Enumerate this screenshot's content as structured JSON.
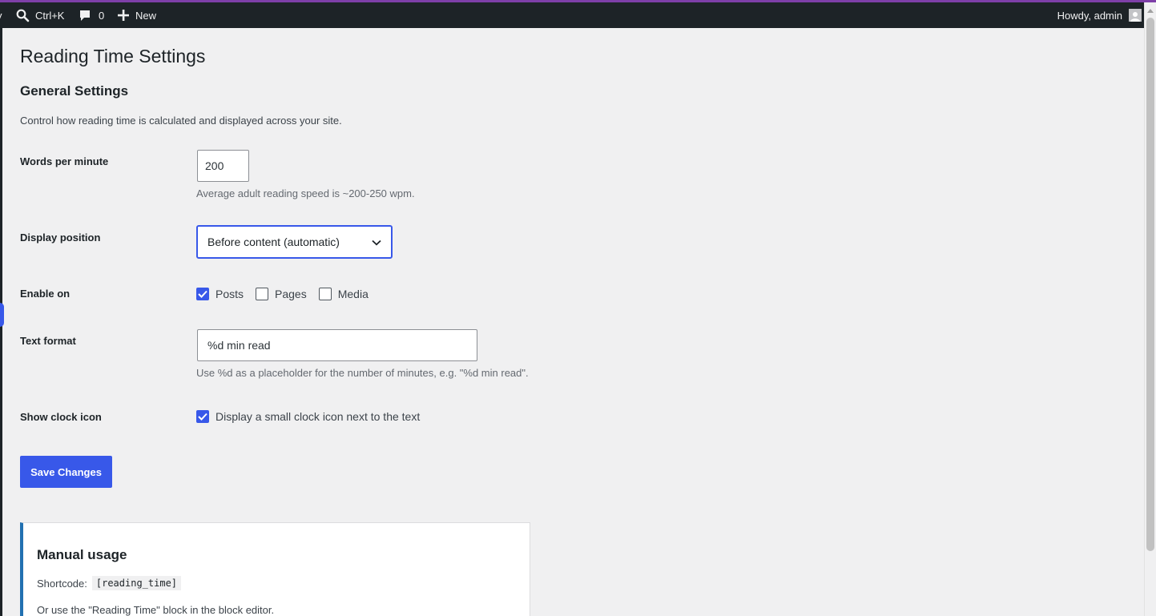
{
  "colors": {
    "accent": "#3858e9",
    "admin_bar": "#1d2327",
    "background": "#f0f0f1",
    "card_border": "#2271b1"
  },
  "adminbar": {
    "search_shortcut": "Ctrl+K",
    "comments_count": "0",
    "new_label": "New",
    "howdy": "Howdy, admin",
    "icons": [
      "search-icon",
      "comment-bubble-icon",
      "plus-icon",
      "avatar-icon"
    ]
  },
  "page": {
    "title": "Reading Time Settings"
  },
  "general": {
    "title": "General Settings",
    "description": "Control how reading time is calculated and displayed across your site."
  },
  "fields": {
    "wpm": {
      "label": "Words per minute",
      "value": "200",
      "help": "Average adult reading speed is ~200-250 wpm."
    },
    "position": {
      "label": "Display position",
      "selected": "Before content (automatic)"
    },
    "enable_on": {
      "label": "Enable on",
      "options": [
        {
          "label": "Posts",
          "checked": true
        },
        {
          "label": "Pages",
          "checked": false
        },
        {
          "label": "Media",
          "checked": false
        }
      ]
    },
    "text_format": {
      "label": "Text format",
      "value": "%d min read",
      "help": "Use %d as a placeholder for the number of minutes, e.g. \"%d min read\"."
    },
    "clock_icon": {
      "label": "Show clock icon",
      "option_label": "Display a small clock icon next to the text",
      "checked": true
    }
  },
  "save_button": "Save Changes",
  "manual": {
    "title": "Manual usage",
    "shortcode_label": "Shortcode:",
    "shortcode": "[reading_time]",
    "block_note": "Or use the \"Reading Time\" block in the block editor."
  }
}
